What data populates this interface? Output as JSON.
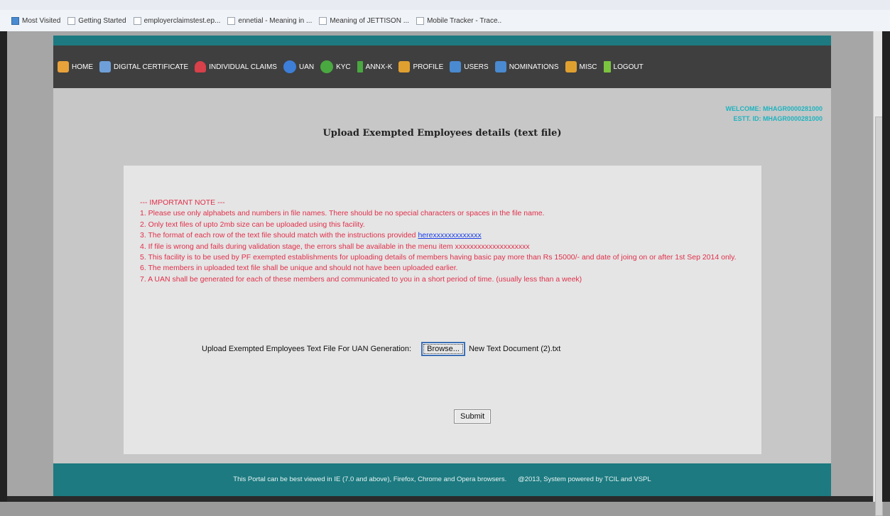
{
  "browser": {
    "bookmarks": [
      {
        "label": "Most Visited",
        "icon": "star-icon"
      },
      {
        "label": "Getting Started",
        "icon": "page-icon"
      },
      {
        "label": "employerclaimstest.ep...",
        "icon": "page-icon"
      },
      {
        "label": "ennetial - Meaning in ...",
        "icon": "page-icon"
      },
      {
        "label": "Meaning of JETTISON ...",
        "icon": "page-icon"
      },
      {
        "label": "Mobile Tracker - Trace..",
        "icon": "page-icon"
      }
    ]
  },
  "nav": {
    "items": [
      {
        "label": "HOME",
        "icon": "home-icon",
        "color": "#e8a23a"
      },
      {
        "label": "DIGITAL CERTIFICATE",
        "icon": "certificate-icon",
        "color": "#6f9fd8"
      },
      {
        "label": "INDIVIDUAL CLAIMS",
        "icon": "person-icon",
        "color": "#d8404a"
      },
      {
        "label": "UAN",
        "icon": "uan-icon",
        "color": "#3d7ed8"
      },
      {
        "label": "KYC",
        "icon": "kyc-icon",
        "color": "#4aa840"
      },
      {
        "label": "ANNX-K",
        "icon": "download-arrow-icon",
        "color": "#4aa840"
      },
      {
        "label": "PROFILE",
        "icon": "profile-icon",
        "color": "#e0a030"
      },
      {
        "label": "USERS",
        "icon": "users-icon",
        "color": "#4a8ad0"
      },
      {
        "label": "NOMINATIONS",
        "icon": "nominations-icon",
        "color": "#4a8ad0"
      },
      {
        "label": "MISC",
        "icon": "misc-icon",
        "color": "#e0a030"
      },
      {
        "label": "LOGOUT",
        "icon": "up-arrow-icon",
        "color": "#7cc440"
      }
    ]
  },
  "header": {
    "welcome": "WELCOME: MHAGR0000281000",
    "estt_id": "ESTT. ID: MHAGR0000281000",
    "title": "Upload Exempted Employees details (text file)"
  },
  "note": {
    "heading": "--- IMPORTANT NOTE ---",
    "line1": "1. Please use only alphabets and numbers in file names. There should be no special characters or spaces in the file name.",
    "line2": "2. Only text files of upto 2mb size can be uploaded using this facility.",
    "line3_text": "3. The format of each row of the text file should match with the instructions provided ",
    "line3_link": "herexxxxxxxxxxxxx",
    "line4": "4. If file is wrong and fails during validation stage, the errors shall be available in the menu item xxxxxxxxxxxxxxxxxxxx",
    "line5": "5. This facility is to be used by PF exempted establishments for uploading details of members having basic pay more than Rs 15000/- and date of joing on or after 1st Sep 2014 only.",
    "line6": "6. The members in uploaded text file shall be unique and should not have been uploaded earlier.",
    "line7": "7. A UAN shall be generated for each of these members and communicated to you in a short period of time. (usually less than a week)"
  },
  "upload": {
    "label": "Upload Exempted Employees Text File For UAN Generation:",
    "browse_label": "Browse...",
    "file_name": "New Text Document (2).txt",
    "submit_label": "Submit"
  },
  "footer": {
    "text": "This Portal can be best viewed in IE (7.0 and above), Firefox, Chrome and Opera browsers.      @2013, System powered by TCIL and VSPL"
  }
}
